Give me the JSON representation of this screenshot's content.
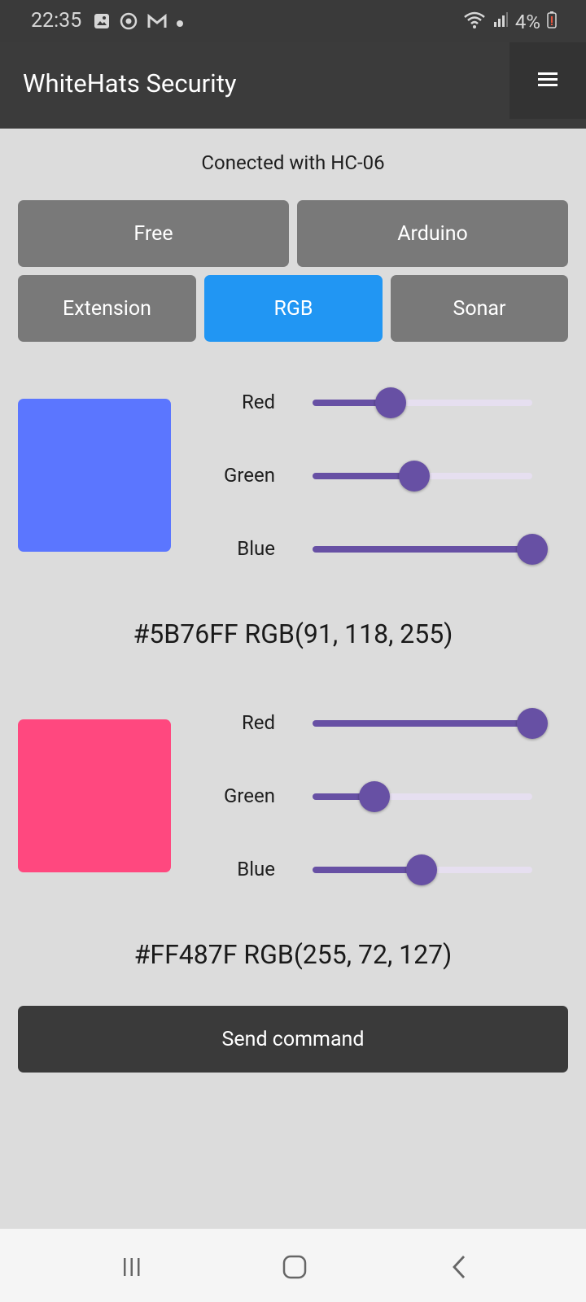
{
  "status_bar": {
    "time": "22:35",
    "battery": "4%",
    "left_icons": [
      "image-icon",
      "sync-icon",
      "gmail-icon",
      "dot-icon"
    ],
    "right_icons": [
      "wifi-icon",
      "signal-icon",
      "battery-icon"
    ]
  },
  "app_bar": {
    "title": "WhiteHats Security",
    "menu_icon": "hamburger-menu-icon"
  },
  "connection_text": "Conected with HC-06",
  "modes": {
    "row1": [
      "Free",
      "Arduino"
    ],
    "row2": [
      "Extension",
      "RGB",
      "Sonar"
    ],
    "active": "RGB",
    "active_color": "#2196f3",
    "inactive_color": "#797979"
  },
  "colors": [
    {
      "swatch": "#5B76FF",
      "hex_text": "#5B76FF RGB(91, 118, 255)",
      "sliders": [
        {
          "label": "Red",
          "value": 91,
          "max": 255
        },
        {
          "label": "Green",
          "value": 118,
          "max": 255
        },
        {
          "label": "Blue",
          "value": 255,
          "max": 255
        }
      ]
    },
    {
      "swatch": "#FF487F",
      "hex_text": "#FF487F RGB(255, 72, 127)",
      "sliders": [
        {
          "label": "Red",
          "value": 255,
          "max": 255
        },
        {
          "label": "Green",
          "value": 72,
          "max": 255
        },
        {
          "label": "Blue",
          "value": 127,
          "max": 255
        }
      ]
    }
  ],
  "send_button": "Send command",
  "nav_bar": {
    "items": [
      "recent-apps-icon",
      "home-icon",
      "back-icon"
    ]
  }
}
